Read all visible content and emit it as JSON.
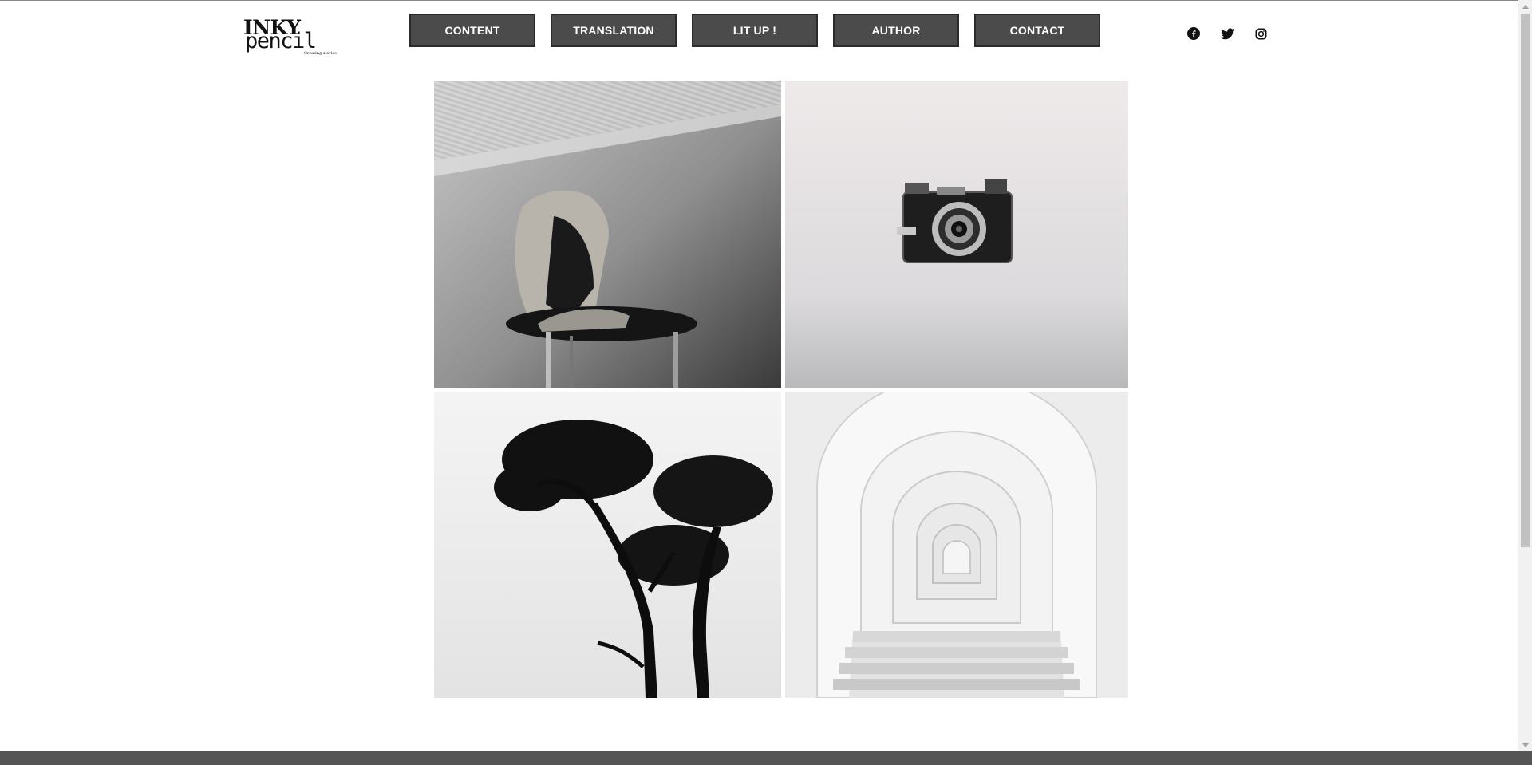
{
  "logo": {
    "line1": "INKY",
    "line2": "pencil",
    "tagline": "Creating stories"
  },
  "nav": {
    "items": [
      {
        "label": "CONTENT"
      },
      {
        "label": "TRANSLATION"
      },
      {
        "label": "LIT UP !"
      },
      {
        "label": "AUTHOR"
      },
      {
        "label": "CONTACT"
      }
    ]
  },
  "social": {
    "icons": [
      "facebook-icon",
      "twitter-icon",
      "instagram-icon"
    ]
  },
  "gallery": {
    "images": [
      {
        "subject": "chair-with-jacket"
      },
      {
        "subject": "vintage-camera"
      },
      {
        "subject": "tree-silhouette"
      },
      {
        "subject": "white-arches-corridor"
      }
    ]
  },
  "colors": {
    "nav_button_bg": "#4b4b4b",
    "nav_button_border": "#2b2b2b",
    "nav_button_text": "#ffffff",
    "footer_bar": "#555555",
    "page_bg": "#ffffff"
  }
}
